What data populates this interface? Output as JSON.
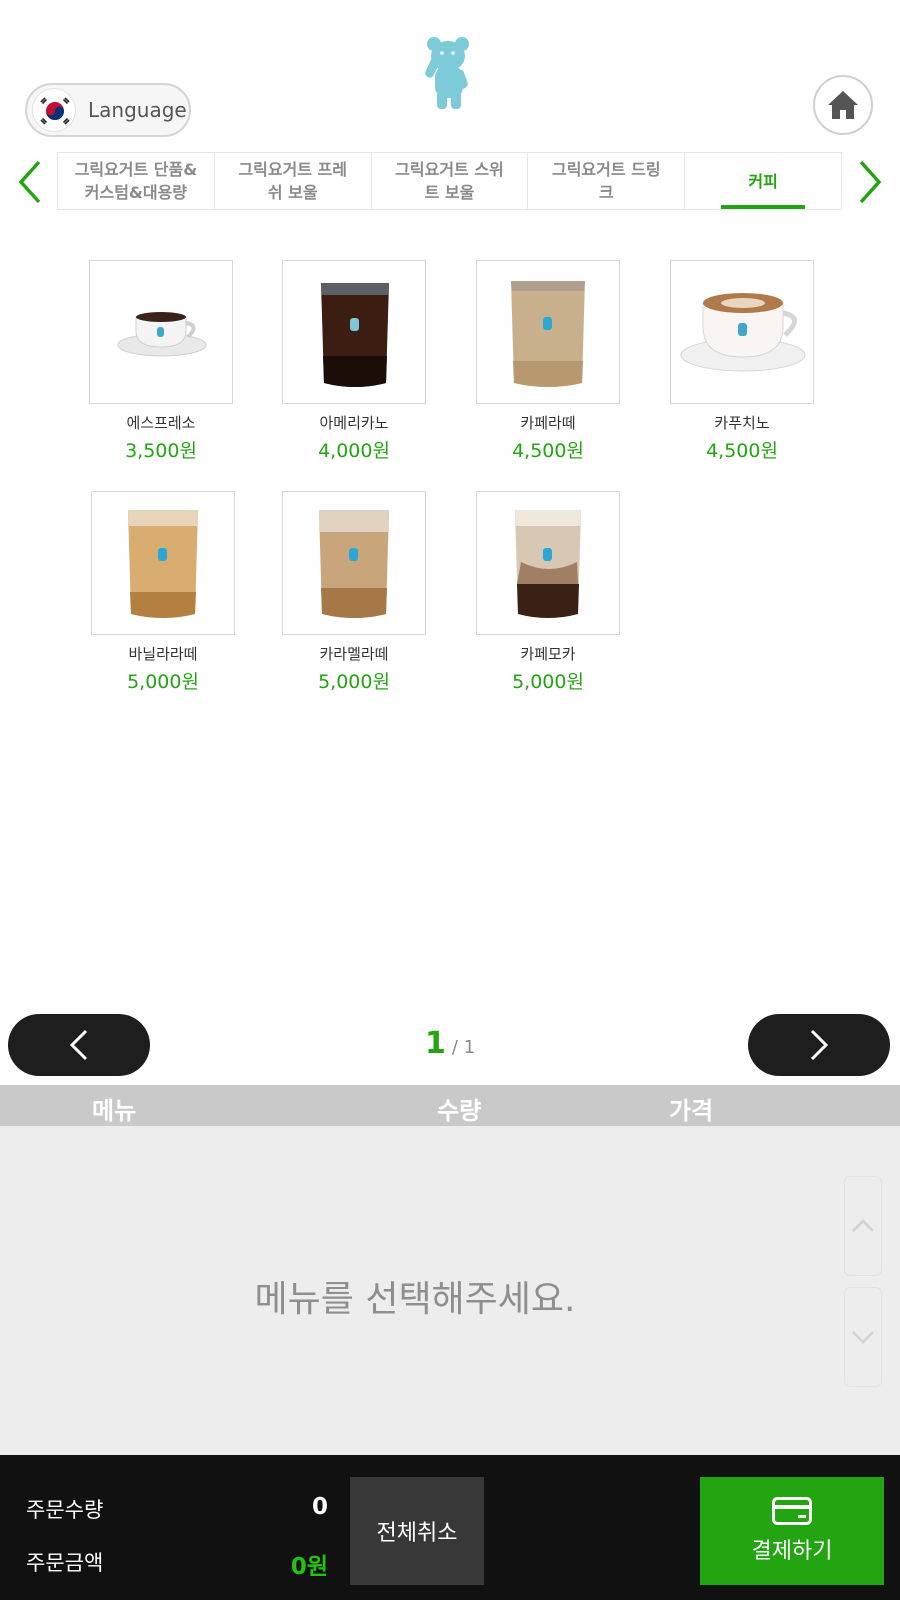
{
  "header": {
    "language_label": "Language"
  },
  "categories": {
    "tabs": [
      {
        "label": "그릭요거트 단품&\n커스텀&대용량"
      },
      {
        "label": "그릭요거트 프레\n쉬 보울"
      },
      {
        "label": "그릭요거트 스위\n트 보울"
      },
      {
        "label": "그릭요거트 드링\n크"
      },
      {
        "label": "커피"
      }
    ],
    "active_index": 4
  },
  "products": [
    {
      "name": "에스프레소",
      "price": "3,500원",
      "image": "espresso-cup"
    },
    {
      "name": "아메리카노",
      "price": "4,000원",
      "image": "iced-americano"
    },
    {
      "name": "카페라떼",
      "price": "4,500원",
      "image": "iced-latte"
    },
    {
      "name": "카푸치노",
      "price": "4,500원",
      "image": "cappuccino-cup"
    },
    {
      "name": "바닐라라떼",
      "price": "5,000원",
      "image": "iced-vanilla-latte"
    },
    {
      "name": "카라멜라떼",
      "price": "5,000원",
      "image": "iced-caramel-latte"
    },
    {
      "name": "카페모카",
      "price": "5,000원",
      "image": "iced-cafe-mocha"
    }
  ],
  "pagination": {
    "current": "1",
    "total_text": "/ 1"
  },
  "order": {
    "col_menu": "메뉴",
    "col_qty": "수량",
    "col_price": "가격",
    "empty_message": "메뉴를 선택해주세요."
  },
  "footer": {
    "qty_label": "주문수량",
    "qty_value": "0",
    "amount_label": "주문금액",
    "amount_value": "0원",
    "cancel_label": "전체취소",
    "pay_label": "결제하기"
  },
  "colors": {
    "accent": "#23a511",
    "dark": "#111111",
    "bear": "#7dcbd9"
  }
}
